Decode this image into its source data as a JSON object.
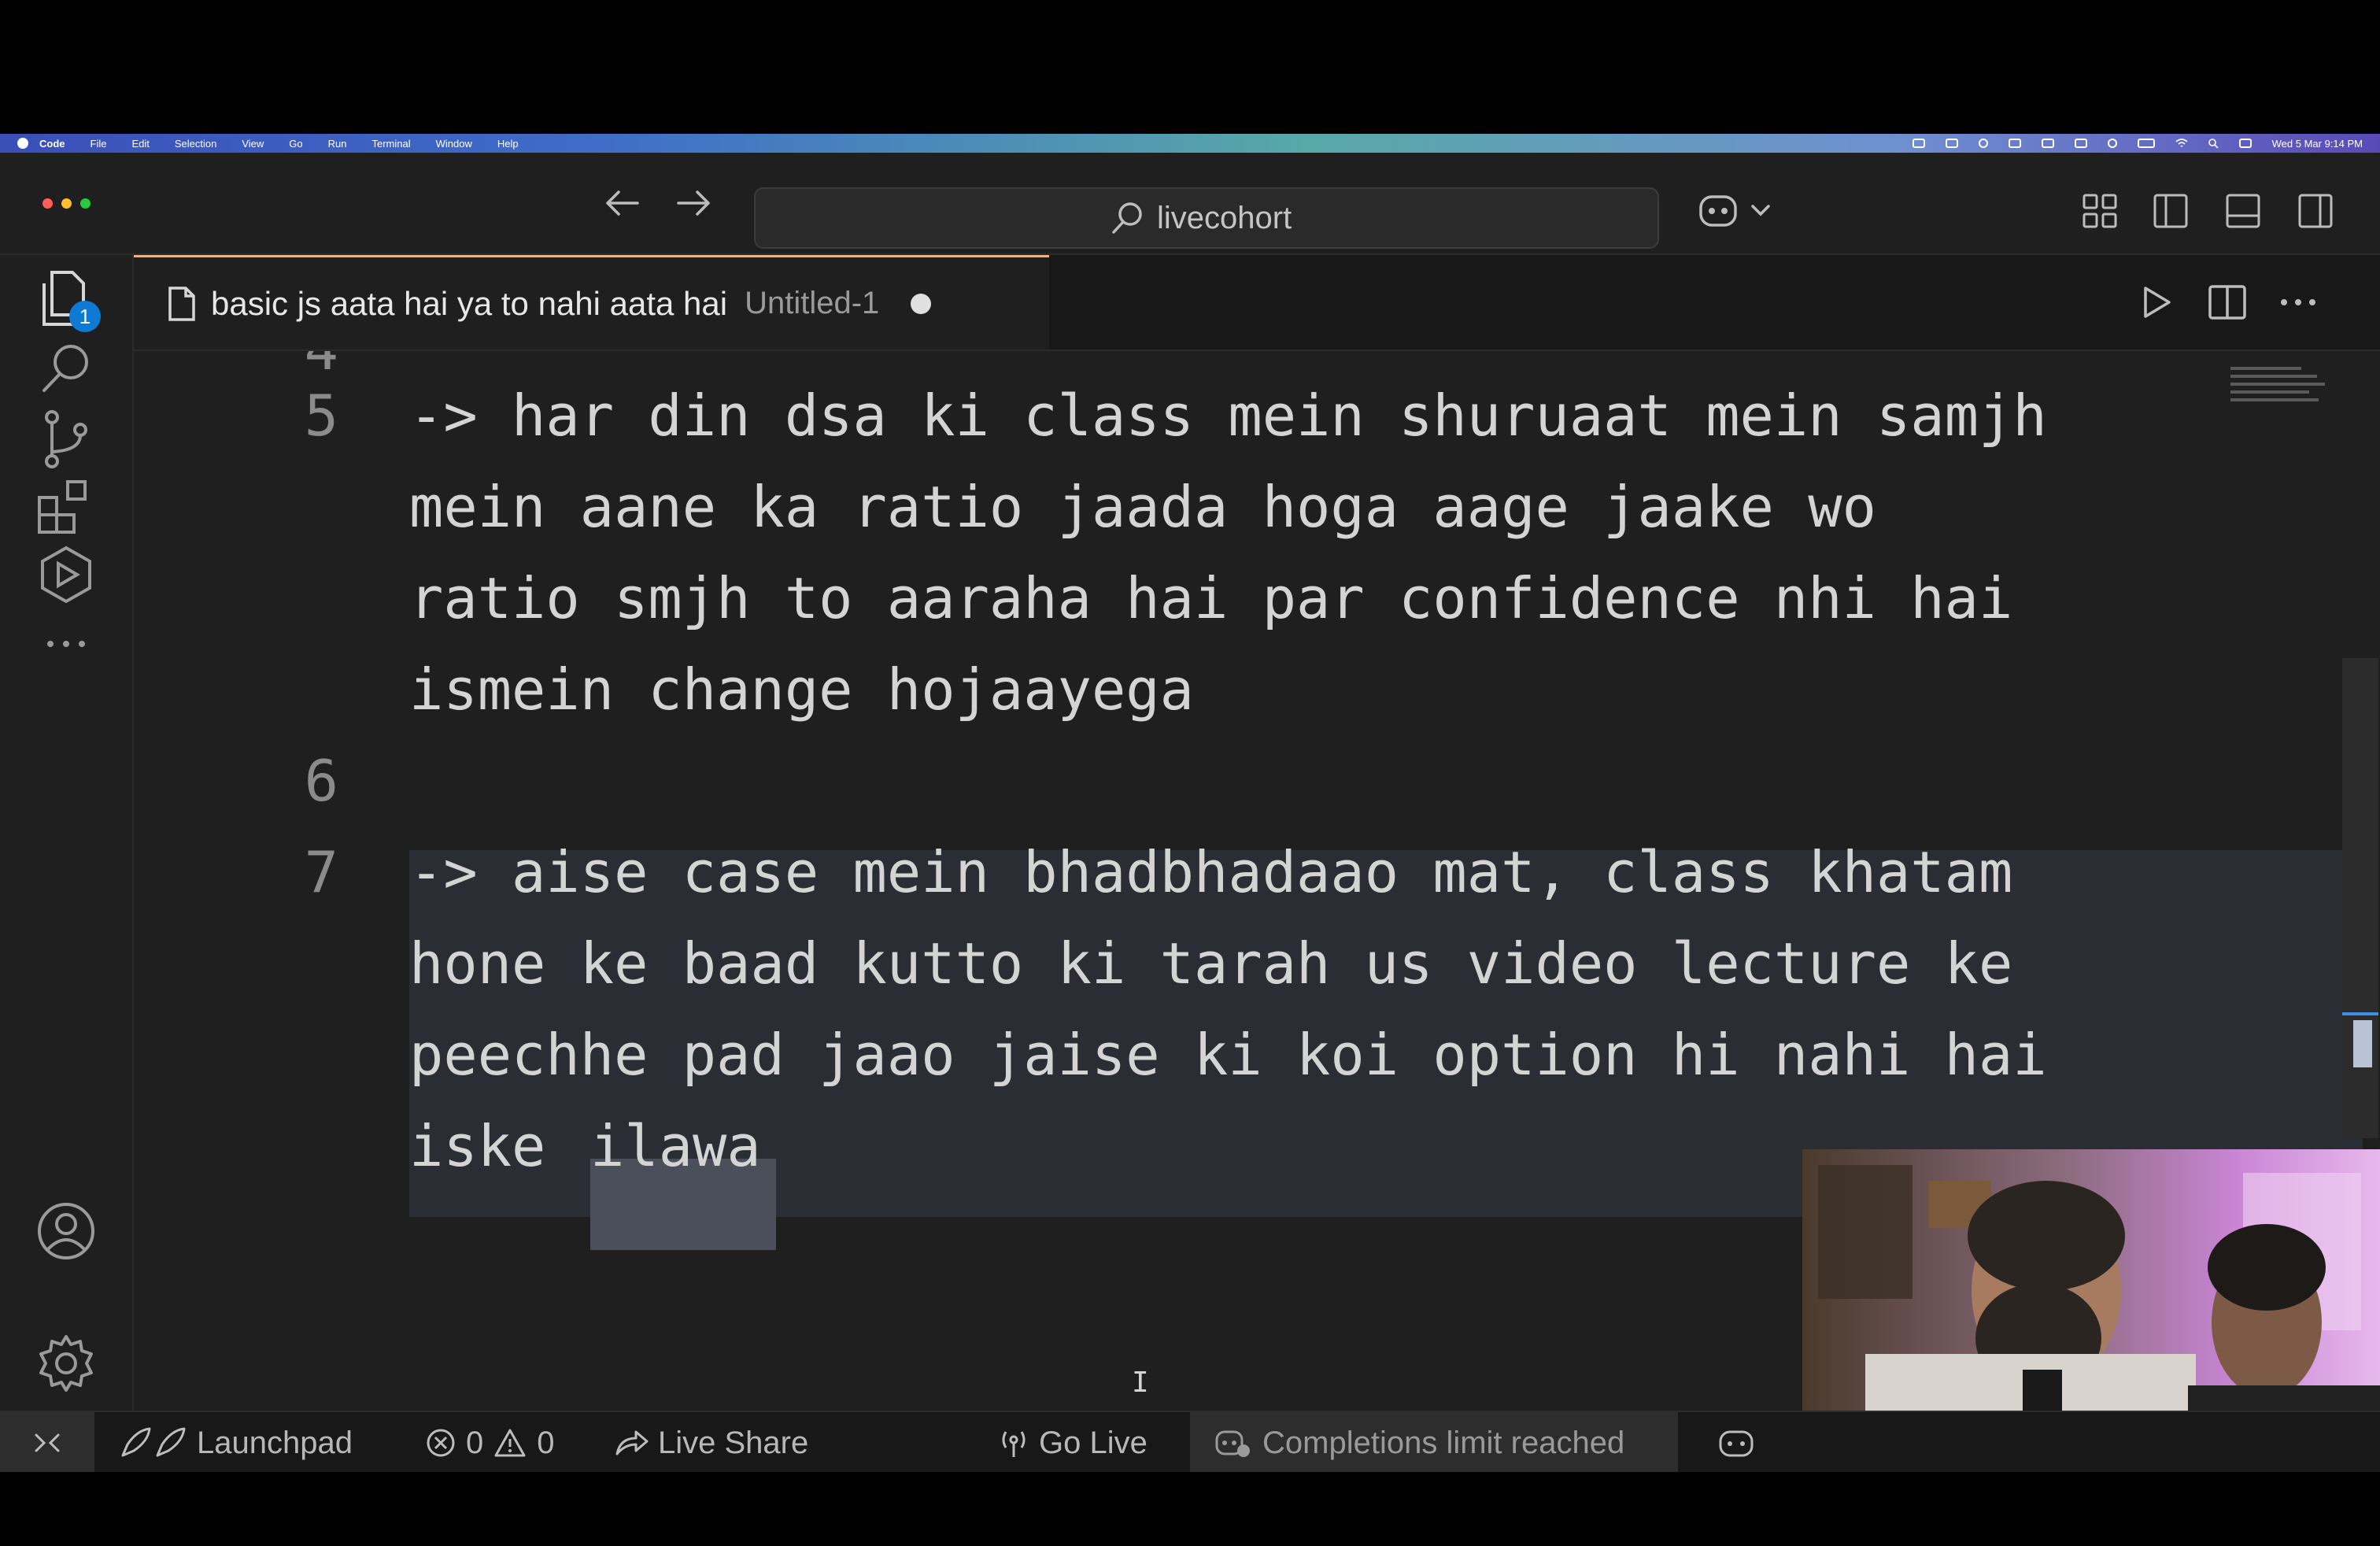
{
  "menubar": {
    "app": "Code",
    "items": [
      "File",
      "Edit",
      "Selection",
      "View",
      "Go",
      "Run",
      "Terminal",
      "Window",
      "Help"
    ],
    "clock": "Wed 5 Mar 9:14 PM"
  },
  "titlebar": {
    "search_text": "livecohort"
  },
  "activity": {
    "explorer_badge": "1"
  },
  "tab": {
    "name": "basic js aata hai ya to nahi aata hai",
    "description": "Untitled-1"
  },
  "editor": {
    "partial_line_number": "4",
    "lines": [
      {
        "number": "5",
        "rows": [
          "-> har din dsa ki class mein shuruaat mein samjh",
          "mein aane ka ratio jaada hoga aage jaake wo",
          "ratio smjh to aaraha hai par confidence nhi hai",
          "ismein change hojaayega"
        ]
      },
      {
        "number": "6",
        "rows": [
          ""
        ]
      },
      {
        "number": "7",
        "rows": [
          "-> aise case mein bhadbhadaao mat, class khatam",
          "hone ke baad kutto ki tarah us video lecture ke",
          "peechhe pad jaao jaise ki koi option hi nahi hai",
          "iske "
        ]
      }
    ],
    "selected_word": "ilawa"
  },
  "statusbar": {
    "launchpad": "Launchpad",
    "errors": "0",
    "warnings": "0",
    "live_share": "Live Share",
    "go_live": "Go Live",
    "completions": "Completions limit reached"
  },
  "colors": {
    "editor_bg": "#1f1f1f",
    "tab_accent": "#e7b38a",
    "badge": "#0e7ad3"
  }
}
